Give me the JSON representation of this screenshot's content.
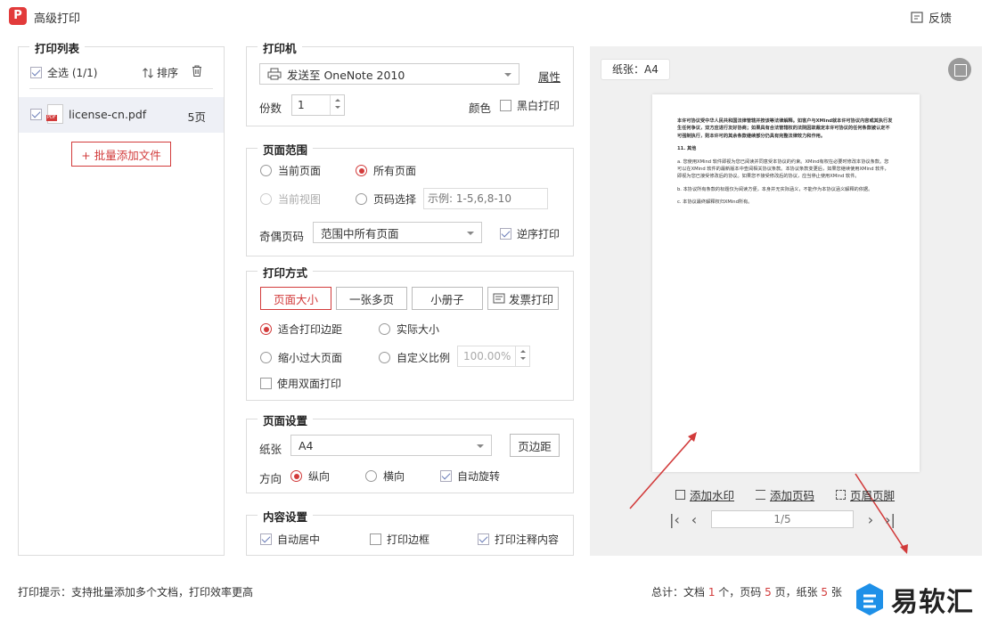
{
  "app": {
    "logo_letter": "P",
    "title": "高级打印",
    "feedback": "反馈"
  },
  "print_list": {
    "title": "打印列表",
    "select_all": "全选 (1/1)",
    "sort": "排序",
    "file": {
      "name": "license-cn.pdf",
      "pages": "5页",
      "icon_text": "PDF"
    },
    "add_files": "+ 批量添加文件"
  },
  "printer": {
    "title": "打印机",
    "selected": "发送至 OneNote 2010",
    "properties": "属性",
    "copies_label": "份数",
    "copies_value": "1",
    "color_label": "颜色",
    "bw_label": "黑白打印"
  },
  "page_range": {
    "title": "页面范围",
    "current_page": "当前页面",
    "all_pages": "所有页面",
    "current_view": "当前视图",
    "page_select": "页码选择",
    "page_select_placeholder": "示例: 1-5,6,8-10",
    "odd_even_label": "奇偶页码",
    "odd_even_value": "范围中所有页面",
    "reverse": "逆序打印"
  },
  "print_mode": {
    "title": "打印方式",
    "tabs": [
      "页面大小",
      "一张多页",
      "小册子",
      "发票打印"
    ],
    "fit_margin": "适合打印边距",
    "actual_size": "实际大小",
    "shrink": "缩小过大页面",
    "custom_scale": "自定义比例",
    "scale_value": "100.00%",
    "duplex": "使用双面打印"
  },
  "page_setup": {
    "title": "页面设置",
    "paper_label": "纸张",
    "paper_value": "A4",
    "margins_btn": "页边距",
    "orientation_label": "方向",
    "portrait": "纵向",
    "landscape": "横向",
    "auto_rotate": "自动旋转"
  },
  "content_setup": {
    "title": "内容设置",
    "center": "自动居中",
    "border": "打印边框",
    "annotations": "打印注释内容"
  },
  "preview": {
    "paper_tag": "纸张：A4",
    "page_text": [
      "本许可协议受中华人民共和国法律管辖并按该等法律解释。如客户与XMind就本许可协议内容或其执行发生任何争议，双方应进行友好协商；如果具有合法管辖权的法院因故裁定本许可协议的任何条款被认定不可强制执行，则本许可的其余条款继续部分仍具有完整法律效力和作用。",
      "11. 其他",
      "a. 您使用XMind 软件即视为您已阅读并同意受本协议的约束。XMind有权在必要时修改本协议条款。您可以在XMind 软件的最新版本中查阅相关协议条款。本协议条款变更后，如果您继续使用XMind 软件，即视为您已接受修改后的协议。如果您不接受修改后的协议，应当停止使用XMind 软件。",
      "b. 本协议所有条款的标题仅为阅读方便，本身并无实际涵义，不能作为本协议涵义解释的依据。",
      "c. 本协议最终解释权归XMind所有。"
    ],
    "add_watermark": "添加水印",
    "add_page_number": "添加页码",
    "header_footer": "页眉页脚",
    "page_indicator": "1/5"
  },
  "footer": {
    "tip": "打印提示：支持批量添加多个文档，打印效率更高",
    "summary_prefix": "总计：文档 ",
    "docs": "1",
    "summary_mid1": " 个，页码 ",
    "pages": "5",
    "summary_mid2": " 页，纸张 ",
    "sheets": "5",
    "summary_suffix": " 张"
  },
  "watermark": {
    "text": "易软汇"
  },
  "colors": {
    "accent": "#d23b3b",
    "preview_bg": "#f0f0f0",
    "selected_row": "#eef0f6"
  }
}
